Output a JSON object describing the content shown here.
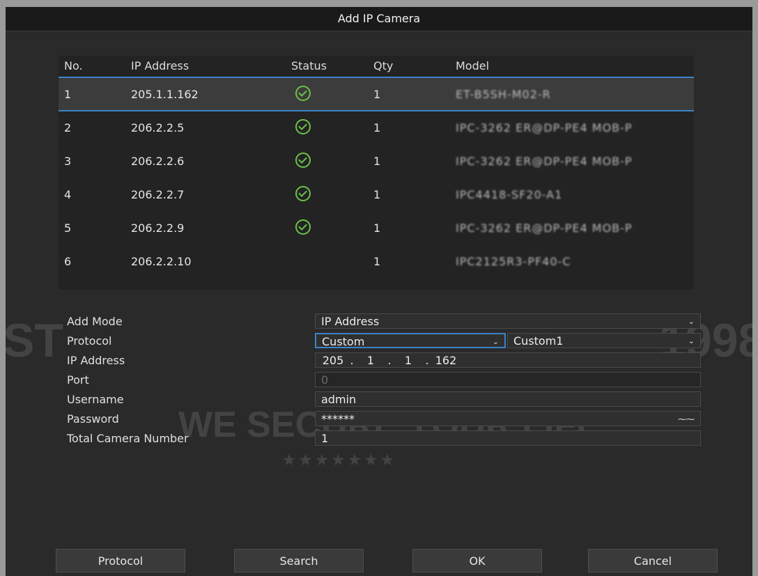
{
  "dialog": {
    "title": "Add IP Camera"
  },
  "table": {
    "headers": {
      "no": "No.",
      "ip": "IP Address",
      "status": "Status",
      "qty": "Qty",
      "model": "Model"
    },
    "rows": [
      {
        "no": "1",
        "ip": "205.1.1.162",
        "status": "ok",
        "qty": "1",
        "model": "ET-B5SH-M02-R"
      },
      {
        "no": "2",
        "ip": "206.2.2.5",
        "status": "ok",
        "qty": "1",
        "model": "IPC-3262 ER@DP-PE4 MOB-P"
      },
      {
        "no": "3",
        "ip": "206.2.2.6",
        "status": "ok",
        "qty": "1",
        "model": "IPC-3262 ER@DP-PE4 MOB-P"
      },
      {
        "no": "4",
        "ip": "206.2.2.7",
        "status": "ok",
        "qty": "1",
        "model": "IPC4418-SF20-A1"
      },
      {
        "no": "5",
        "ip": "206.2.2.9",
        "status": "ok",
        "qty": "1",
        "model": "IPC-3262 ER@DP-PE4 MOB-P"
      },
      {
        "no": "6",
        "ip": "206.2.2.10",
        "status": "",
        "qty": "1",
        "model": "IPC2125R3-PF40-C"
      }
    ]
  },
  "form": {
    "add_mode": {
      "label": "Add Mode",
      "value": "IP Address"
    },
    "protocol": {
      "label": "Protocol",
      "value": "Custom",
      "value2": "Custom1"
    },
    "ip_address": {
      "label": "IP Address",
      "seg1": "205",
      "seg2": "1",
      "seg3": "1",
      "seg4": "162",
      "dot": "."
    },
    "port": {
      "label": "Port",
      "value": "0"
    },
    "username": {
      "label": "Username",
      "value": "admin"
    },
    "password": {
      "label": "Password",
      "value": "******"
    },
    "total": {
      "label": "Total Camera Number",
      "value": "1"
    }
  },
  "buttons": {
    "protocol": "Protocol",
    "search": "Search",
    "ok": "OK",
    "cancel": "Cancel"
  },
  "watermark": {
    "line1": "WE SECURE YOUR LIFE",
    "year": "1998",
    "left": "ST",
    "stars": "★ ★ ★ ★ ★ ★ ★"
  },
  "colors": {
    "accent": "#3b84c8",
    "status_ok": "#6cc24a"
  }
}
